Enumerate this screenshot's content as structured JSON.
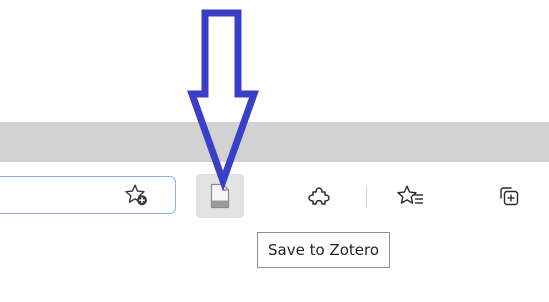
{
  "toolbar": {
    "address_bar": {
      "value": ""
    },
    "buttons": [
      {
        "name": "add-favorite",
        "icon": "star-plus-icon"
      },
      {
        "name": "save-to-zotero",
        "icon": "document-icon"
      },
      {
        "name": "extensions",
        "icon": "puzzle-icon"
      },
      {
        "name": "favorites",
        "icon": "star-list-icon"
      },
      {
        "name": "collections",
        "icon": "collections-plus-icon"
      }
    ]
  },
  "tooltip": {
    "text": "Save to Zotero"
  },
  "annotation": {
    "icon": "down-arrow-icon",
    "color": "#3b3fc8"
  }
}
